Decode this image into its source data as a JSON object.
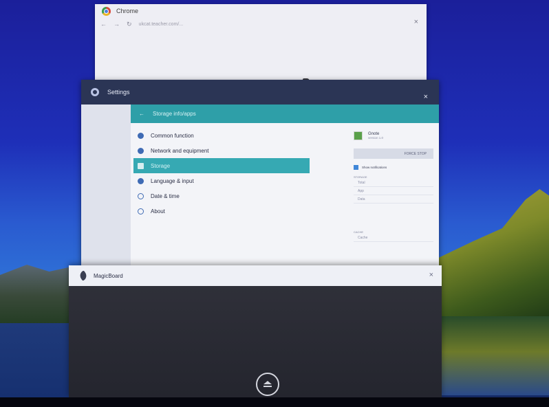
{
  "chrome": {
    "title": "Chrome",
    "nav": {
      "back": "←",
      "forward": "→",
      "reload": "↻"
    },
    "url": "ukcat.teacher.com/...",
    "close": "×"
  },
  "settings": {
    "title": "Settings",
    "close": "×",
    "appbar": {
      "back": "←",
      "title": "Storage info/apps"
    },
    "menu": [
      {
        "label": "Common function"
      },
      {
        "label": "Network and equipment"
      },
      {
        "label": "Storage"
      },
      {
        "label": "Language & input"
      },
      {
        "label": "Date & time"
      },
      {
        "label": "About"
      }
    ],
    "detail": {
      "app_name": "Gnote",
      "app_version": "version 1.0",
      "force_stop": "FORCE STOP",
      "show_notifications": "Show notifications",
      "storage_section": "STORAGE",
      "storage_rows": [
        "Total",
        "App",
        "Data"
      ],
      "cache_section": "CACHE",
      "cache_row": "Cache"
    }
  },
  "magicboard": {
    "title": "MagicBoard",
    "close": "×"
  },
  "colors": {
    "settings_titlebar": "#2b3555",
    "accent_teal": "#2e9fa8",
    "active_item": "#36a9b3",
    "icon_blue": "#3f6bb4"
  },
  "icons": {
    "chrome": "chrome-logo-icon",
    "settings": "gear-icon",
    "magicboard": "feather-icon",
    "home": "eject-icon"
  }
}
